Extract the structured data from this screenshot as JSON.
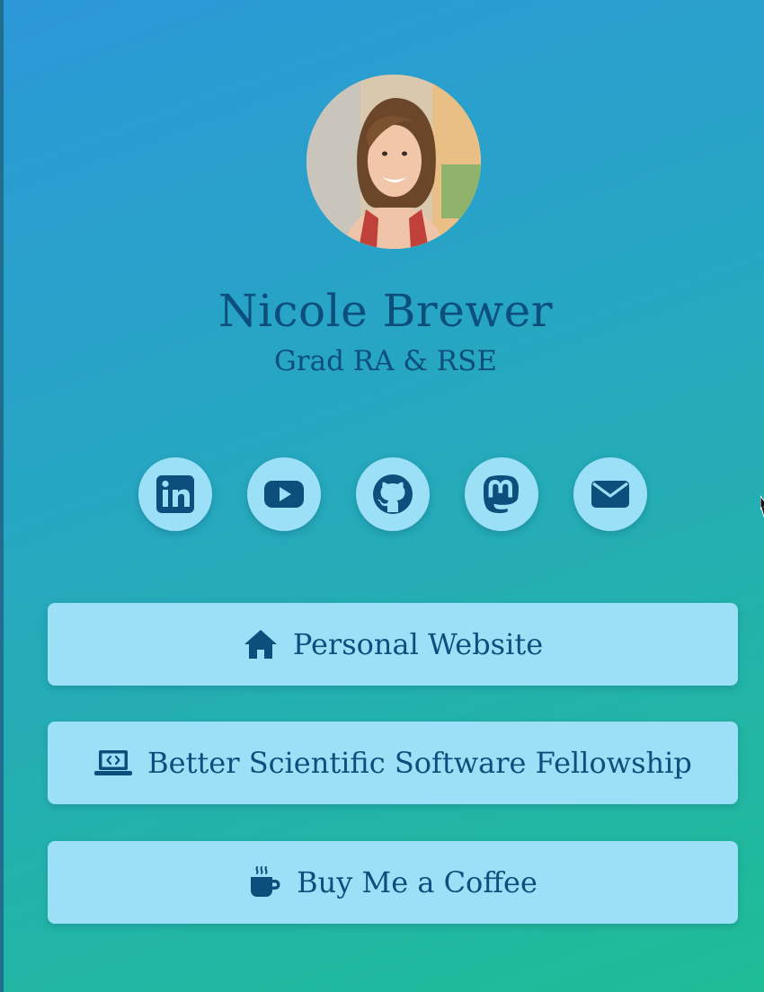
{
  "profile": {
    "name": "Nicole Brewer",
    "title": "Grad RA & RSE",
    "avatar_alt": "avatar"
  },
  "socials": [
    {
      "icon": "linkedin-icon"
    },
    {
      "icon": "youtube-icon"
    },
    {
      "icon": "github-icon"
    },
    {
      "icon": "mastodon-icon"
    },
    {
      "icon": "email-icon"
    }
  ],
  "links": [
    {
      "label": "Personal Website",
      "icon": "home-icon"
    },
    {
      "label": "Better Scientific Software Fellowship",
      "icon": "laptop-code-icon"
    },
    {
      "label": "Buy Me a Coffee",
      "icon": "mug-icon"
    }
  ],
  "colors": {
    "accent": "#0d4f7c",
    "button_bg": "#9be0f7",
    "bg_start": "#2c98d8",
    "bg_end": "#1fbc97"
  }
}
